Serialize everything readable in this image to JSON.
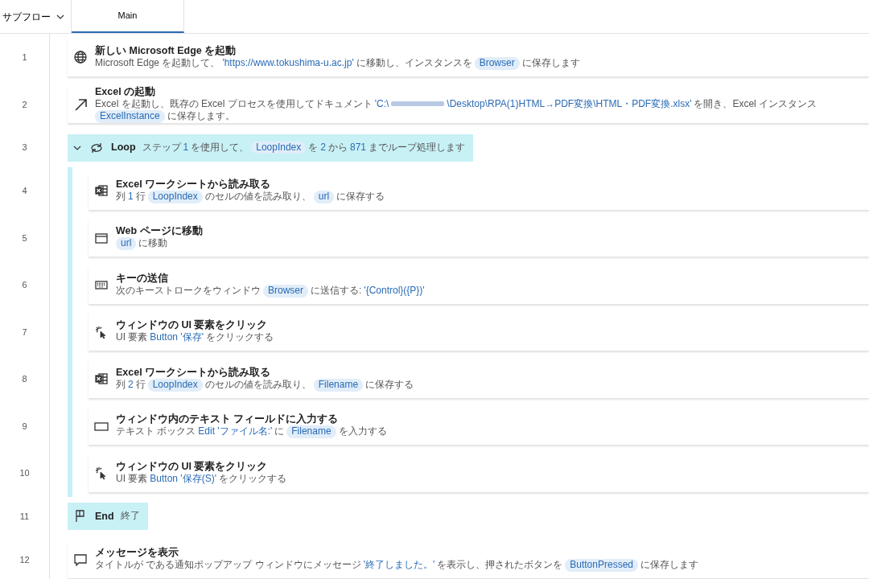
{
  "header": {
    "subflow_label": "サブフロー",
    "tabs": [
      {
        "label": "Main",
        "selected": true
      }
    ]
  },
  "steps": [
    {
      "number": "1",
      "kind": "globe",
      "title": "新しい Microsoft Edge を起動",
      "description": [
        {
          "kind": "text",
          "text": "Microsoft Edge を起動して、"
        },
        {
          "kind": "value",
          "text": "'https://www.tokushima-u.ac.jp'"
        },
        {
          "kind": "text",
          "text": "に移動し、インスタンスを"
        },
        {
          "kind": "variable",
          "text": "Browser"
        },
        {
          "kind": "text",
          "text": "に保存します"
        }
      ]
    },
    {
      "number": "2",
      "kind": "arrow",
      "title": "Excel の起動",
      "description": [
        {
          "kind": "text",
          "text": "Excel を起動し、既存の Excel プロセスを使用してドキュメント"
        },
        {
          "kind": "value",
          "text": "'C:\\"
        },
        {
          "kind": "redaction"
        },
        {
          "kind": "value",
          "text": "\\Desktop\\RPA(1)HTML→PDF変換\\HTML・PDF変換.xlsx'"
        },
        {
          "kind": "text",
          "text": "を開き、Excel インスタンス"
        },
        {
          "kind": "variable",
          "text": "ExcelInstance"
        },
        {
          "kind": "text",
          "text": "に保存します。"
        }
      ]
    },
    {
      "number": "3",
      "kind": "loop",
      "expanded": true,
      "title": "Loop",
      "description": [
        {
          "kind": "text",
          "text": "ステップ"
        },
        {
          "kind": "value",
          "text": "1"
        },
        {
          "kind": "text",
          "text": "を使用して、"
        },
        {
          "kind": "variable",
          "text": "LoopIndex"
        },
        {
          "kind": "text",
          "text": "を"
        },
        {
          "kind": "value",
          "text": "2"
        },
        {
          "kind": "text",
          "text": "から"
        },
        {
          "kind": "value",
          "text": "871"
        },
        {
          "kind": "text",
          "text": "までループ処理します"
        }
      ],
      "children": [
        {
          "number": "4",
          "kind": "excel",
          "title": "Excel ワークシートから読み取る",
          "description": [
            {
              "kind": "text",
              "text": "列"
            },
            {
              "kind": "value",
              "text": "1"
            },
            {
              "kind": "text",
              "text": "行"
            },
            {
              "kind": "variable",
              "text": "LoopIndex"
            },
            {
              "kind": "text",
              "text": "のセルの値を読み取り、"
            },
            {
              "kind": "variable",
              "text": "url"
            },
            {
              "kind": "text",
              "text": "に保存する"
            }
          ]
        },
        {
          "number": "5",
          "kind": "window",
          "title": "Web ページに移動",
          "description": [
            {
              "kind": "variable",
              "text": "url"
            },
            {
              "kind": "text",
              "text": "に移動"
            }
          ]
        },
        {
          "number": "6",
          "kind": "keyboard",
          "title": "キーの送信",
          "description": [
            {
              "kind": "text",
              "text": "次のキーストロークをウィンドウ"
            },
            {
              "kind": "variable",
              "text": "Browser"
            },
            {
              "kind": "text",
              "text": "に送信する:"
            },
            {
              "kind": "value",
              "text": "'{Control}({P})'"
            }
          ]
        },
        {
          "number": "7",
          "kind": "click",
          "title": "ウィンドウの UI 要素をクリック",
          "description": [
            {
              "kind": "text",
              "text": "UI 要素"
            },
            {
              "kind": "value",
              "text": "Button '保存'"
            },
            {
              "kind": "text",
              "text": "をクリックする"
            }
          ]
        },
        {
          "number": "8",
          "kind": "excel",
          "title": "Excel ワークシートから読み取る",
          "description": [
            {
              "kind": "text",
              "text": "列"
            },
            {
              "kind": "value",
              "text": "2"
            },
            {
              "kind": "text",
              "text": "行"
            },
            {
              "kind": "variable",
              "text": "LoopIndex"
            },
            {
              "kind": "text",
              "text": "のセルの値を読み取り、"
            },
            {
              "kind": "variable",
              "text": "Filename"
            },
            {
              "kind": "text",
              "text": "に保存する"
            }
          ]
        },
        {
          "number": "9",
          "kind": "textfield",
          "title": "ウィンドウ内のテキスト フィールドに入力する",
          "description": [
            {
              "kind": "text",
              "text": "テキスト ボックス"
            },
            {
              "kind": "value",
              "text": "Edit 'ファイル名:'"
            },
            {
              "kind": "text",
              "text": "に"
            },
            {
              "kind": "variable",
              "text": "Filename"
            },
            {
              "kind": "text",
              "text": "を入力する"
            }
          ]
        },
        {
          "number": "10",
          "kind": "click",
          "title": "ウィンドウの UI 要素をクリック",
          "description": [
            {
              "kind": "text",
              "text": "UI 要素"
            },
            {
              "kind": "value",
              "text": "Button '保存(S)'"
            },
            {
              "kind": "text",
              "text": "をクリックする"
            }
          ]
        }
      ]
    },
    {
      "number": "11",
      "kind": "flag",
      "title": "End",
      "description": [
        {
          "kind": "text",
          "text": "終了"
        }
      ]
    },
    {
      "number": "12",
      "kind": "message",
      "title": "メッセージを表示",
      "description": [
        {
          "kind": "text",
          "text": "タイトルが  である通知ポップアップ ウィンドウにメッセージ"
        },
        {
          "kind": "value",
          "text": "'終了しました。'"
        },
        {
          "kind": "text",
          "text": "を表示し、押されたボタンを"
        },
        {
          "kind": "variable",
          "text": "ButtonPressed"
        },
        {
          "kind": "text",
          "text": "に保存します"
        }
      ]
    }
  ]
}
